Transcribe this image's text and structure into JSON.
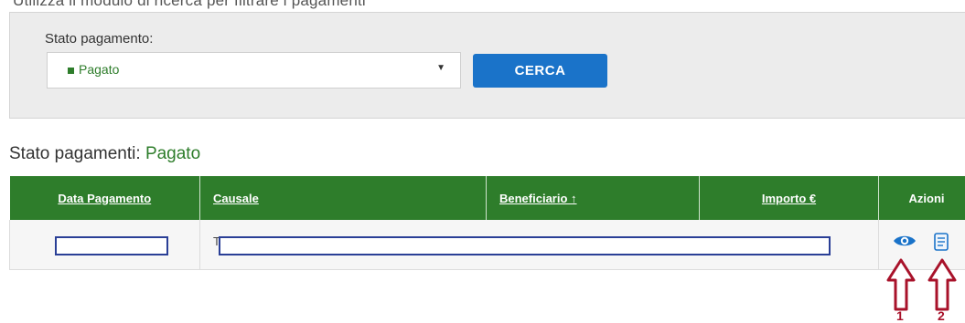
{
  "filter": {
    "heading": "Utilizza il modulo di ricerca per filtrare i pagamenti",
    "label": "Stato pagamento:",
    "selected": "Pagato",
    "search_button": "CERCA"
  },
  "status": {
    "prefix": "Stato pagamenti:",
    "value": "Pagato"
  },
  "table": {
    "columns": [
      "Data Pagamento",
      "Causale",
      "Beneficiario ↑",
      "Importo €",
      "Azioni"
    ],
    "rows": [
      {
        "causale_prefix": "T",
        "actions": [
          "eye-icon",
          "receipt-icon"
        ]
      }
    ]
  },
  "annotations": [
    "1",
    "2"
  ],
  "colors": {
    "header_green": "#2e7d2b",
    "button_blue": "#1a73c9",
    "redaction_blue": "#2a3f96",
    "arrow_red": "#a8122a"
  }
}
